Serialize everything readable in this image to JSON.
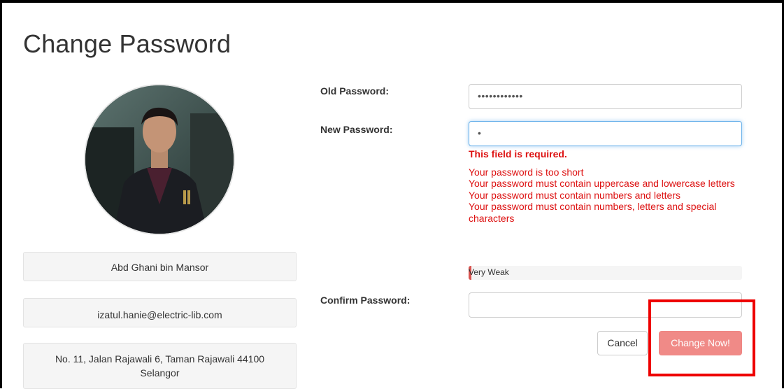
{
  "page": {
    "title": "Change Password"
  },
  "profile": {
    "avatar_icon": "user-photo",
    "name": "Abd Ghani bin Mansor",
    "email": "izatul.hanie@electric-lib.com",
    "address": "No. 11, Jalan Rajawali 6, Taman Rajawali 44100 Selangor"
  },
  "form": {
    "old_password": {
      "label": "Old Password:",
      "masked_value": "••••••••••••"
    },
    "new_password": {
      "label": "New Password:",
      "masked_value": "•",
      "error_required": "This field is required.",
      "messages": [
        "Your password is too short",
        "Your password must contain uppercase and lowercase letters",
        "Your password must contain numbers and letters",
        "Your password must contain numbers, letters and special characters"
      ],
      "strength_label": "Very Weak",
      "strength_fraction": 0.01
    },
    "confirm_password": {
      "label": "Confirm Password:",
      "masked_value": ""
    },
    "buttons": {
      "cancel": "Cancel",
      "submit": "Change Now!"
    }
  },
  "colors": {
    "error": "#dd1111",
    "submit_bg": "#f08a87",
    "highlight": "#ee0000",
    "strength_fill": "#d9534f"
  }
}
